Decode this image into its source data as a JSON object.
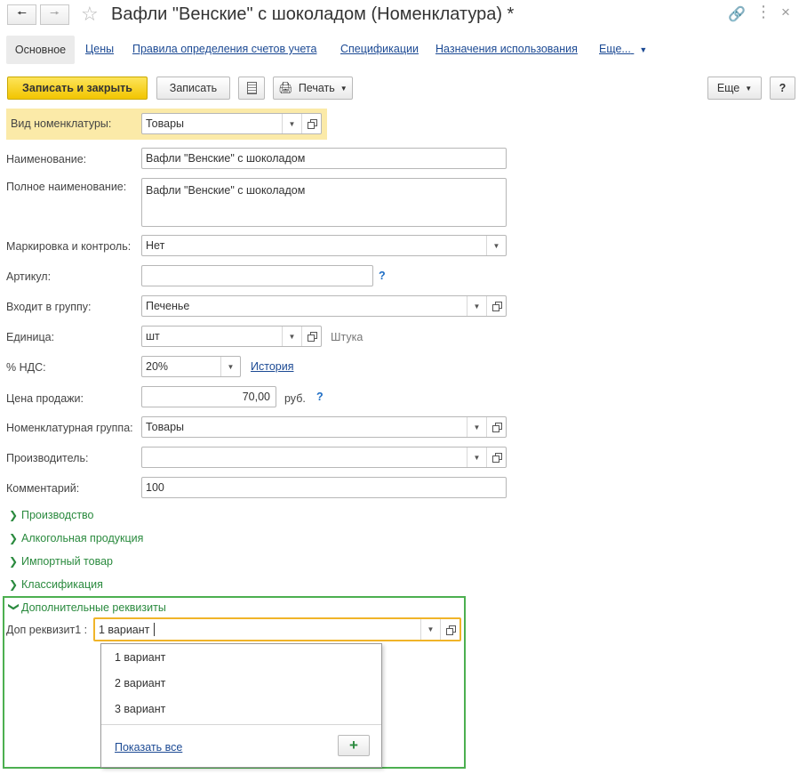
{
  "window": {
    "title": "Вафли \"Венские\" с шоколадом (Номенклатура) *"
  },
  "tabs": {
    "active": "Основное",
    "links": [
      "Цены",
      "Правила определения счетов учета",
      "Спецификации",
      "Назначения использования",
      "Еще..."
    ]
  },
  "toolbar": {
    "save_close": "Записать и закрыть",
    "save": "Записать",
    "print": "Печать",
    "more": "Еще",
    "help": "?"
  },
  "form": {
    "kind_label": "Вид номенклатуры:",
    "kind_value": "Товары",
    "name_label": "Наименование:",
    "name_value": "Вафли \"Венские\" с шоколадом",
    "fullname_label": "Полное наименование:",
    "fullname_value": "Вафли \"Венские\" с шоколадом",
    "marking_label": "Маркировка и контроль:",
    "marking_value": "Нет",
    "article_label": "Артикул:",
    "article_value": "",
    "group_label": "Входит в группу:",
    "group_value": "Печенье",
    "unit_label": "Единица:",
    "unit_value": "шт",
    "unit_note": "Штука",
    "vat_label": "% НДС:",
    "vat_value": "20%",
    "vat_history": "История",
    "price_label": "Цена продажи:",
    "price_value": "70,00",
    "price_currency": "руб.",
    "nomgroup_label": "Номенклатурная группа:",
    "nomgroup_value": "Товары",
    "producer_label": "Производитель:",
    "producer_value": "",
    "comment_label": "Комментарий:",
    "comment_value": "100",
    "help_mark": "?"
  },
  "groups": {
    "production": "Производство",
    "alcohol": "Алкогольная продукция",
    "import": "Импортный товар",
    "classification": "Классификация",
    "extra": "Дополнительные реквизиты"
  },
  "extra": {
    "attr_label": "Доп реквизит1 :",
    "attr_value": "1 вариант",
    "options": [
      "1 вариант",
      "2 вариант",
      "3 вариант"
    ],
    "show_all": "Показать все"
  },
  "colors": {
    "accent_yellow": "#f2c500",
    "highlight_bg": "#fbeaa8",
    "group_green": "#2a8a3e",
    "outline_green": "#4caf50",
    "focus_orange": "#f0b429",
    "link_blue": "#1c4a94"
  }
}
